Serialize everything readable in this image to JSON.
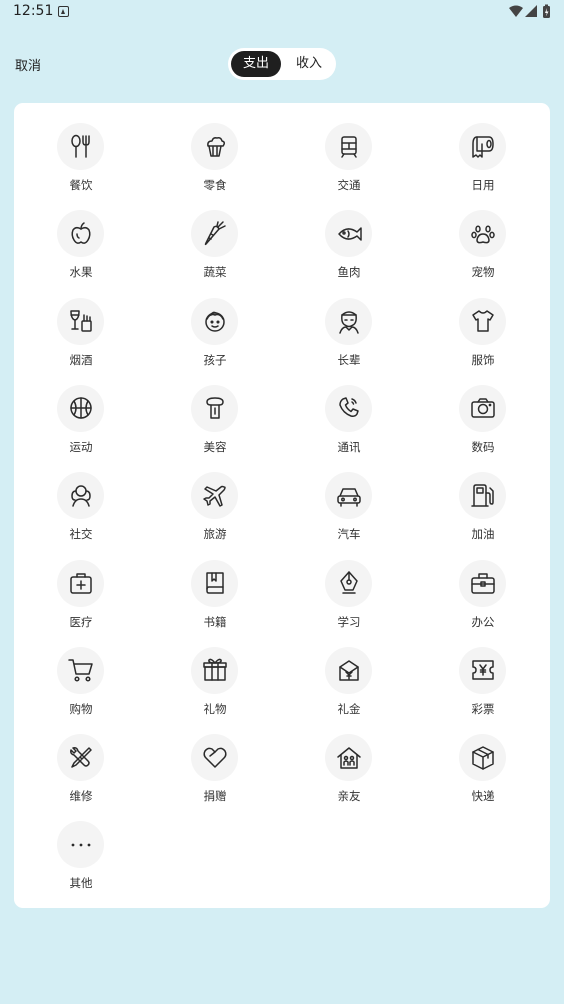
{
  "status_bar": {
    "time": "12:51"
  },
  "header": {
    "cancel_label": "取消",
    "tabs": [
      {
        "label": "支出",
        "selected": true
      },
      {
        "label": "收入",
        "selected": false
      }
    ]
  },
  "categories": [
    {
      "label": "餐饮",
      "icon": "fork-spoon-icon"
    },
    {
      "label": "零食",
      "icon": "cupcake-icon"
    },
    {
      "label": "交通",
      "icon": "train-icon"
    },
    {
      "label": "日用",
      "icon": "toilet-paper-icon"
    },
    {
      "label": "水果",
      "icon": "apple-icon"
    },
    {
      "label": "蔬菜",
      "icon": "carrot-icon"
    },
    {
      "label": "鱼肉",
      "icon": "fish-icon"
    },
    {
      "label": "宠物",
      "icon": "paw-icon"
    },
    {
      "label": "烟酒",
      "icon": "wine-cigarette-icon"
    },
    {
      "label": "孩子",
      "icon": "child-face-icon"
    },
    {
      "label": "长辈",
      "icon": "elder-icon"
    },
    {
      "label": "服饰",
      "icon": "tshirt-icon"
    },
    {
      "label": "运动",
      "icon": "basketball-icon"
    },
    {
      "label": "美容",
      "icon": "lipstick-icon"
    },
    {
      "label": "通讯",
      "icon": "phone-icon"
    },
    {
      "label": "数码",
      "icon": "camera-icon"
    },
    {
      "label": "社交",
      "icon": "people-icon"
    },
    {
      "label": "旅游",
      "icon": "airplane-icon"
    },
    {
      "label": "汽车",
      "icon": "car-icon"
    },
    {
      "label": "加油",
      "icon": "gas-pump-icon"
    },
    {
      "label": "医疗",
      "icon": "first-aid-kit-icon"
    },
    {
      "label": "书籍",
      "icon": "book-icon"
    },
    {
      "label": "学习",
      "icon": "pen-nib-icon"
    },
    {
      "label": "办公",
      "icon": "briefcase-icon"
    },
    {
      "label": "购物",
      "icon": "shopping-cart-icon"
    },
    {
      "label": "礼物",
      "icon": "gift-icon"
    },
    {
      "label": "礼金",
      "icon": "red-envelope-icon"
    },
    {
      "label": "彩票",
      "icon": "lottery-ticket-icon"
    },
    {
      "label": "维修",
      "icon": "wrench-screwdriver-icon"
    },
    {
      "label": "捐赠",
      "icon": "heart-icon"
    },
    {
      "label": "亲友",
      "icon": "house-family-icon"
    },
    {
      "label": "快递",
      "icon": "package-icon"
    },
    {
      "label": "其他",
      "icon": "more-dots-icon"
    }
  ]
}
